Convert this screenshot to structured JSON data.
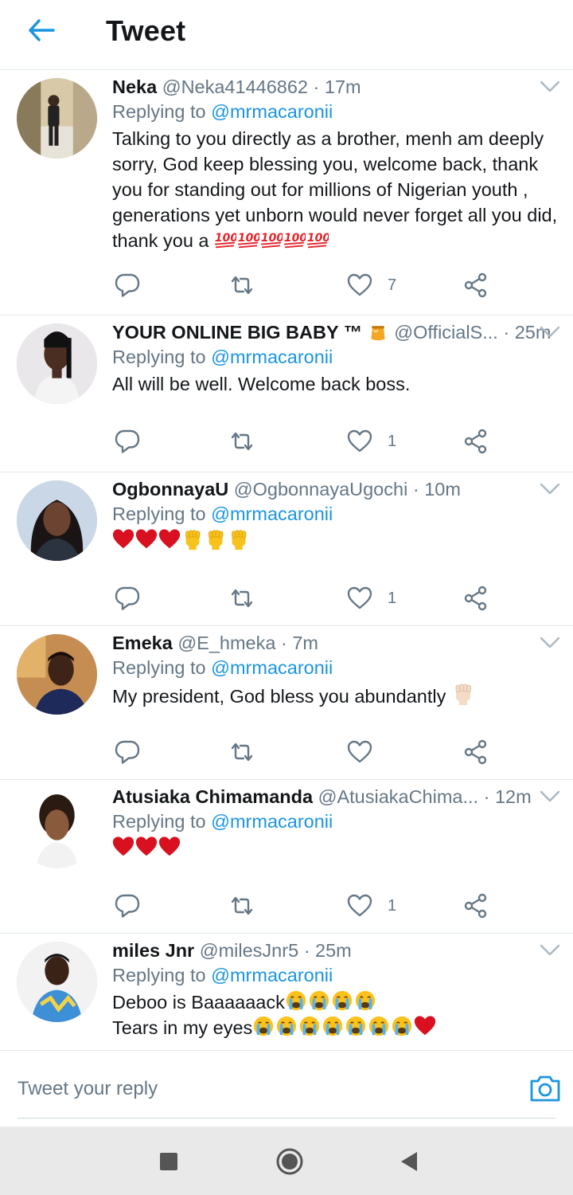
{
  "header": {
    "title": "Tweet"
  },
  "tweets": [
    {
      "name": "Neka",
      "handle": "@Neka41446862",
      "time": "17m",
      "reply_prefix": "Replying to",
      "reply_to": "@mrmacaronii",
      "text": "Talking to you directly as a brother, menh am deeply sorry, God keep blessing you, welcome back, thank you for standing out for millions of  Nigerian youth , generations yet unborn would never forget all you did, thank you a",
      "emoji": [
        "hundred-points",
        "hundred-points",
        "hundred-points",
        "hundred-points",
        "hundred-points"
      ],
      "likes": "7"
    },
    {
      "name": "YOUR ONLINE BIG BABY ™",
      "handle": "@OfficialS...",
      "time": "25m",
      "reply_prefix": "Replying to",
      "reply_to": "@mrmacaronii",
      "text": "All will be well. Welcome back boss.",
      "name_emoji": "honey-pot",
      "likes": "1"
    },
    {
      "name": "OgbonnayaU",
      "handle": "@OgbonnayaUgochi",
      "time": "10m",
      "reply_prefix": "Replying to",
      "reply_to": "@mrmacaronii",
      "text": "",
      "emoji": [
        "red-heart",
        "red-heart",
        "red-heart",
        "raised-fist",
        "raised-fist",
        "raised-fist"
      ],
      "likes": "1"
    },
    {
      "name": "Emeka",
      "handle": "@E_hmeka",
      "time": "7m",
      "reply_prefix": "Replying to",
      "reply_to": "@mrmacaronii",
      "text": "My president, God bless you abundantly ",
      "emoji": [
        "raised-fist-light"
      ],
      "likes": ""
    },
    {
      "name": "Atusiaka Chimamanda",
      "handle": "@AtusiakaChima...",
      "time": "12m",
      "reply_prefix": "Replying to",
      "reply_to": "@mrmacaronii",
      "text": "",
      "emoji": [
        "red-heart",
        "red-heart",
        "red-heart"
      ],
      "likes": "1"
    },
    {
      "name": "miles Jnr",
      "handle": "@milesJnr5",
      "time": "25m",
      "reply_prefix": "Replying to",
      "reply_to": "@mrmacaronii",
      "text_line1": "Deboo is Baaaaaack",
      "text_line2": "Tears in my eyes"
    }
  ],
  "reply_bar": {
    "placeholder": "Tweet your reply"
  },
  "colors": {
    "accent": "#1b95e0",
    "secondary_text": "#657786",
    "divider": "#e1e8ed",
    "heart": "#e0245e"
  },
  "icons": [
    "back-arrow-icon",
    "chevron-down-icon",
    "reply-icon",
    "retweet-icon",
    "like-icon",
    "share-icon",
    "camera-icon",
    "nav-recents-icon",
    "nav-home-icon",
    "nav-back-icon"
  ]
}
